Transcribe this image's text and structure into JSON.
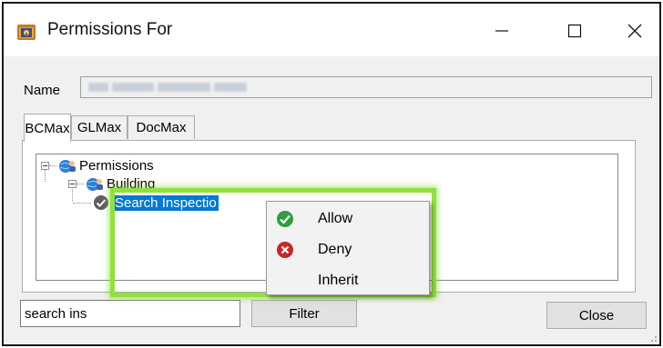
{
  "window": {
    "title": "Permissions For",
    "app_icon": "lock-folder-icon",
    "controls": {
      "minimize": "minimize-icon",
      "maximize": "maximize-icon",
      "close": "close-icon"
    }
  },
  "name_row": {
    "label": "Name",
    "value_state": "blurred"
  },
  "tabs": [
    {
      "label": "BCMax",
      "active": true
    },
    {
      "label": "GLMax",
      "active": false
    },
    {
      "label": "DocMax",
      "active": false
    }
  ],
  "tree": {
    "nodes": [
      {
        "label": "Permissions",
        "icon": "globe-users-icon",
        "expanded": true
      },
      {
        "label": "Building",
        "icon": "globe-users-icon",
        "expanded": true
      },
      {
        "label": "Search Inspectio",
        "icon": "check-circle-gray-icon",
        "selected": true
      }
    ]
  },
  "context_menu": {
    "items": [
      {
        "label": "Allow",
        "icon": "check-circle-green-icon"
      },
      {
        "label": "Deny",
        "icon": "x-circle-red-icon"
      },
      {
        "label": "Inherit",
        "icon": ""
      }
    ]
  },
  "filter_row": {
    "search_value": "search ins",
    "filter_label": "Filter",
    "close_label": "Close"
  },
  "colors": {
    "highlight": "#8fe23a",
    "selection": "#0078d7",
    "allow": "#2e9e3e",
    "deny": "#c8262b"
  }
}
